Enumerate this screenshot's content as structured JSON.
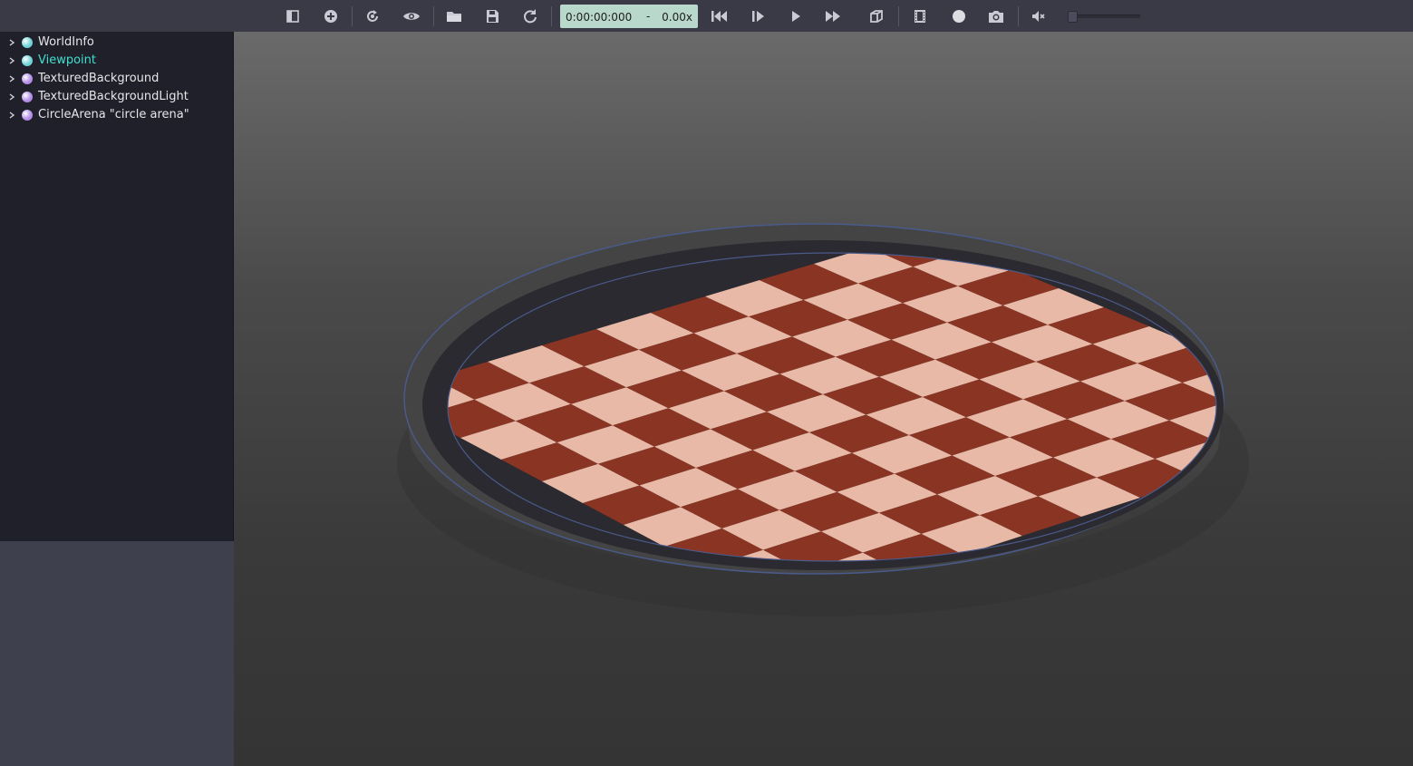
{
  "toolbar": {
    "buttons": [
      {
        "name": "toggle-scene-tree-button",
        "icon": "panel-toggle-icon"
      },
      {
        "name": "add-node-button",
        "icon": "plus-circle-icon"
      },
      {
        "name": "reset-simulation-button",
        "icon": "reset-icon"
      },
      {
        "name": "view-options-button",
        "icon": "eye-icon"
      },
      {
        "name": "open-world-button",
        "icon": "folder-icon"
      },
      {
        "name": "save-world-button",
        "icon": "save-icon"
      },
      {
        "name": "reload-world-button",
        "icon": "reload-icon"
      },
      {
        "name": "reset-time-button",
        "icon": "skip-back-icon"
      },
      {
        "name": "step-button",
        "icon": "step-icon"
      },
      {
        "name": "play-button",
        "icon": "play-icon"
      },
      {
        "name": "fast-forward-button",
        "icon": "fast-forward-icon"
      },
      {
        "name": "rendering-toggle-button",
        "icon": "cube-icon"
      },
      {
        "name": "record-movie-button",
        "icon": "film-icon"
      },
      {
        "name": "record-animation-button",
        "icon": "record-circle-icon"
      },
      {
        "name": "screenshot-button",
        "icon": "camera-icon"
      },
      {
        "name": "mute-button",
        "icon": "speaker-muted-icon"
      }
    ],
    "time": "0:00:00:000",
    "dash": "-",
    "speed": "0.00x",
    "volume": 0
  },
  "scene_tree": {
    "items": [
      {
        "label": "WorldInfo",
        "dot_color": "#6fd3d6",
        "selected": false
      },
      {
        "label": "Viewpoint",
        "dot_color": "#6fd3d6",
        "selected": true
      },
      {
        "label": "TexturedBackground",
        "dot_color": "#b38ee6",
        "selected": false
      },
      {
        "label": "TexturedBackgroundLight",
        "dot_color": "#b38ee6",
        "selected": false
      },
      {
        "label": "CircleArena \"circle arena\"",
        "dot_color": "#b38ee6",
        "selected": false
      }
    ]
  },
  "colors": {
    "selected_text": "#3fe0d0",
    "default_text": "#e6e6ea",
    "floor_dark": "#8a3424",
    "floor_light": "#e8b9a6",
    "wall": "#3b3b3b"
  }
}
